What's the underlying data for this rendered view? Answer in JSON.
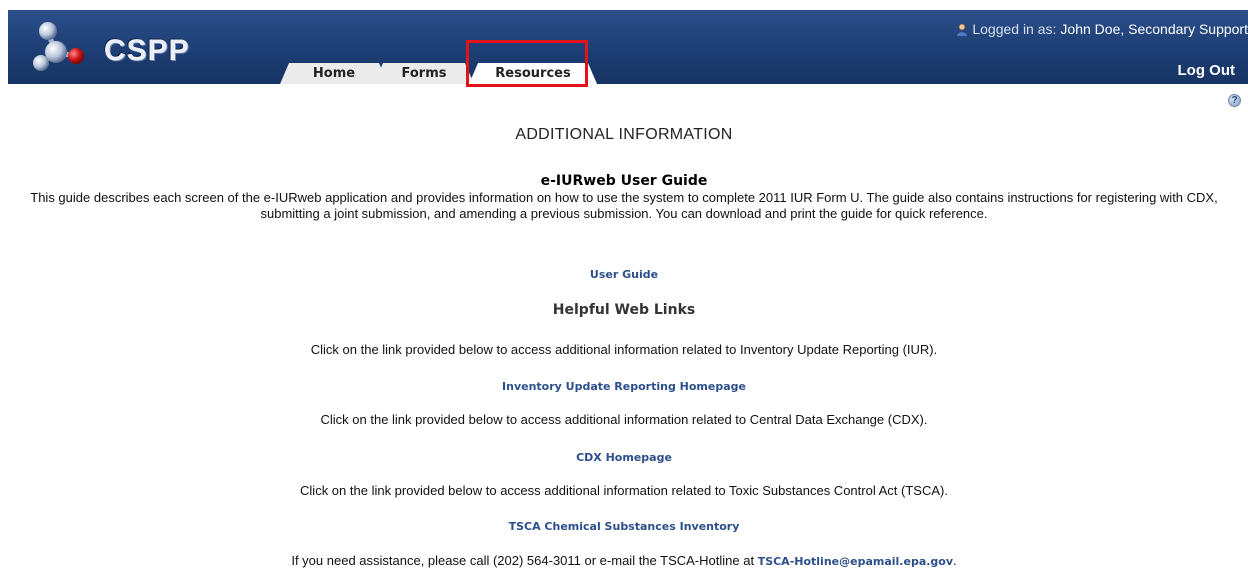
{
  "header": {
    "logo_text": "CSPP",
    "tabs": [
      {
        "label": "Home"
      },
      {
        "label": "Forms"
      },
      {
        "label": "Resources"
      }
    ],
    "user_prefix": "Logged in as:",
    "user_name": "John Doe, Secondary Support",
    "logout_label": "Log Out",
    "user_icon": "user-icon",
    "help_icon": "help-icon",
    "highlight_color": "#e3131a"
  },
  "main": {
    "title": "ADDITIONAL INFORMATION",
    "guide_heading": "e-IURweb User Guide",
    "guide_text": "This guide describes each screen of the e-IURweb application and provides information on how to use the system to complete 2011 IUR Form U. The guide also contains instructions for registering with CDX, submitting a joint submission, and amending a previous submission. You can download and print the guide for quick reference.",
    "user_guide_link": "User Guide",
    "links_heading": "Helpful Web Links",
    "iur_text": "Click on the link provided below to access additional information related to Inventory Update Reporting (IUR).",
    "iur_link": "Inventory Update Reporting Homepage",
    "cdx_text": "Click on the link provided below to access additional information related to Central Data Exchange (CDX).",
    "cdx_link": "CDX Homepage",
    "tsca_text": "Click on the link provided below to access additional information related to Toxic Substances Control Act (TSCA).",
    "tsca_link": "TSCA Chemical Substances Inventory",
    "contact_text": "If you need assistance, please call (202) 564-3011 or e-mail the TSCA-Hotline at",
    "contact_email": "TSCA-Hotline@epamail.epa.gov",
    "contact_end": "."
  }
}
